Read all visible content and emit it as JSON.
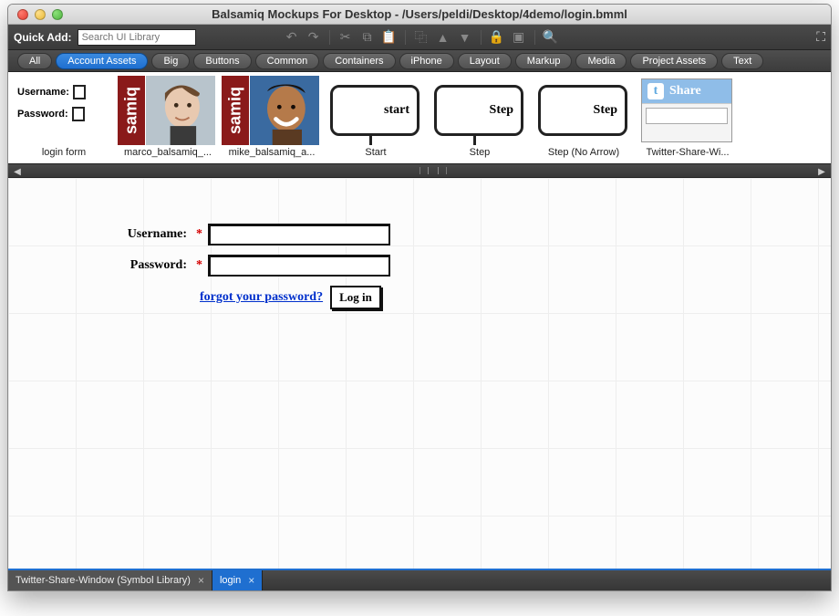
{
  "window": {
    "title": "Balsamiq Mockups For Desktop - /Users/peldi/Desktop/4demo/login.bmml"
  },
  "toolbar": {
    "quickadd_label": "Quick Add:",
    "search_placeholder": "Search UI Library"
  },
  "categories": {
    "items": [
      {
        "label": "All",
        "active": false
      },
      {
        "label": "Account Assets",
        "active": true
      },
      {
        "label": "Big",
        "active": false
      },
      {
        "label": "Buttons",
        "active": false
      },
      {
        "label": "Common",
        "active": false
      },
      {
        "label": "Containers",
        "active": false
      },
      {
        "label": "iPhone",
        "active": false
      },
      {
        "label": "Layout",
        "active": false
      },
      {
        "label": "Markup",
        "active": false
      },
      {
        "label": "Media",
        "active": false
      },
      {
        "label": "Project Assets",
        "active": false
      },
      {
        "label": "Text",
        "active": false
      }
    ]
  },
  "library": {
    "items": [
      {
        "label": "login form",
        "thumb_lines": [
          "Username:",
          "Password:"
        ],
        "brand": ""
      },
      {
        "label": "marco_balsamiq_...",
        "brand": "samiq"
      },
      {
        "label": "mike_balsamiq_a...",
        "brand": "samiq"
      },
      {
        "label": "Start",
        "step_text": "start"
      },
      {
        "label": "Step",
        "step_text": "Step"
      },
      {
        "label": "Step (No Arrow)",
        "step_text": "Step"
      },
      {
        "label": "Twitter-Share-Wi...",
        "tw_label": "Share"
      }
    ]
  },
  "canvas_form": {
    "username_label": "Username:",
    "password_label": "Password:",
    "forgot_text": "forgot your password?",
    "login_button": "Log in"
  },
  "bottom_tabs": {
    "items": [
      {
        "label": "Twitter-Share-Window (Symbol Library)",
        "active": false
      },
      {
        "label": "login",
        "active": true
      }
    ]
  }
}
